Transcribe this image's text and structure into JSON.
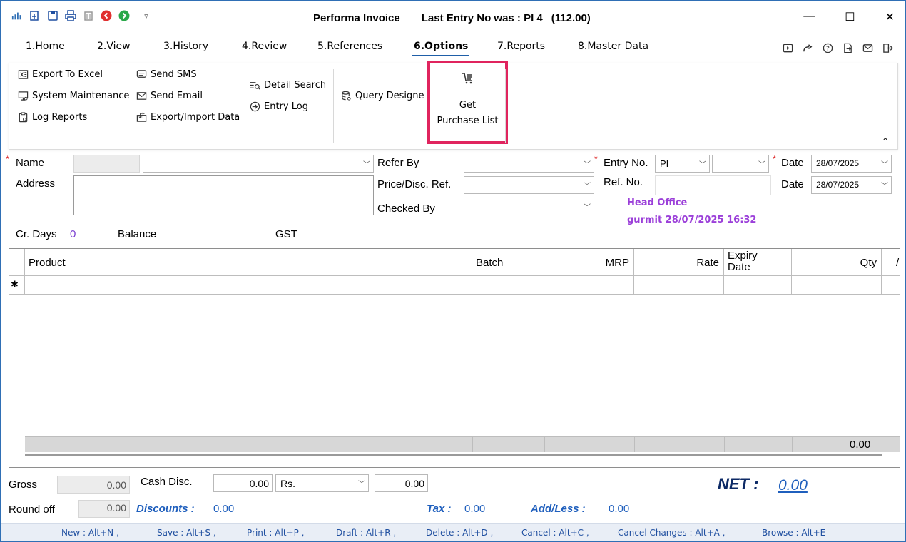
{
  "titlebar": {
    "title": "Performa Invoice",
    "last_entry": "Last Entry No was : PI 4",
    "amount": "(112.00)",
    "minimize": "—",
    "maximize": "☐",
    "close": "✕"
  },
  "tabs": [
    "1.Home",
    "2.View",
    "3.History",
    "4.Review",
    "5.References",
    "6.Options",
    "7.Reports",
    "8.Master Data"
  ],
  "ribbon": {
    "export_excel": "Export To Excel",
    "system_maintenance": "System Maintenance",
    "log_reports": "Log Reports",
    "send_sms": "Send SMS",
    "send_email": "Send Email",
    "export_import": "Export/Import Data",
    "detail_search": "Detail Search",
    "entry_log": "Entry Log",
    "query_designer": "Query Designe",
    "get_line1": "Get",
    "get_line2": "Purchase List"
  },
  "form": {
    "name_label": "Name",
    "address_label": "Address",
    "refer_by_label": "Refer By",
    "price_disc_ref_label": "Price/Disc. Ref.",
    "checked_by_label": "Checked By",
    "entry_no_label": "Entry No.",
    "entry_prefix": "PI",
    "ref_no_label": "Ref. No.",
    "date_label": "Date",
    "date1": "28/07/2025",
    "date2": "28/07/2025",
    "head_office": "Head Office",
    "user_stamp": "gurmit 28/07/2025 16:32",
    "cr_days_label": "Cr. Days",
    "cr_days_value": "0",
    "balance_label": "Balance",
    "gst_label": "GST"
  },
  "grid": {
    "columns": [
      "Product",
      "Batch",
      "MRP",
      "Rate",
      "Expiry Date",
      "Qty"
    ],
    "new_row_marker": "✱",
    "total_qty": "0.00"
  },
  "totals": {
    "gross_label": "Gross",
    "gross_value": "0.00",
    "cash_disc_label": "Cash Disc.",
    "cash_disc_value": "0.00",
    "cash_disc_unit": "Rs.",
    "cash_disc_amount": "0.00",
    "round_off_label": "Round off",
    "round_off_value": "0.00",
    "discounts_label": "Discounts :",
    "discounts_value": "0.00",
    "tax_label": "Tax :",
    "tax_value": "0.00",
    "add_less_label": "Add/Less :",
    "add_less_value": "0.00",
    "net_label": "NET :",
    "net_value": "0.00"
  },
  "shortcuts": [
    "New : Alt+N ,",
    "Save : Alt+S ,",
    "Print : Alt+P ,",
    "Draft : Alt+R ,",
    "Delete : Alt+D ,",
    "Cancel : Alt+C ,",
    "Cancel Changes : Alt+A ,",
    "Browse : Alt+E"
  ],
  "colors": {
    "frame": "#2f6fb5",
    "highlight": "#e0245e",
    "link": "#1f5fbd",
    "purple": "#9b3fd9"
  }
}
